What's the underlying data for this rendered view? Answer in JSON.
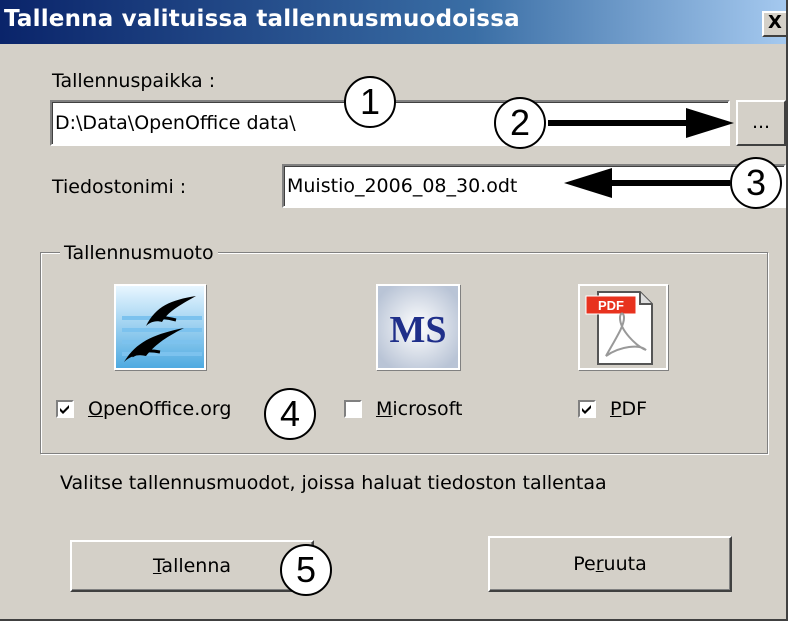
{
  "window": {
    "title": "Tallenna valituissa tallennusmuodoissa",
    "close_label": "X"
  },
  "location": {
    "label": "Tallennuspaikka :",
    "value": "D:\\Data\\OpenOffice data\\",
    "browse_label": "..."
  },
  "filename": {
    "label": "Tiedostonimi :",
    "value": "Muistio_2006_08_30.odt"
  },
  "formats": {
    "group_title": "Tallennusmuoto",
    "items": [
      {
        "key": "O",
        "rest": "penOffice.org",
        "checked": true,
        "icon": "openoffice-icon"
      },
      {
        "key": "M",
        "rest": "icrosoft",
        "checked": false,
        "icon": "ms-icon",
        "icon_text": "MS"
      },
      {
        "key": "P",
        "rest": "DF",
        "checked": true,
        "icon": "pdf-icon",
        "icon_text": "PDF"
      }
    ]
  },
  "hint": "Valitse tallennusmuodot, joissa haluat tiedoston tallentaa",
  "buttons": {
    "save": {
      "key": "T",
      "rest": "allenna"
    },
    "cancel": {
      "pre": "Pe",
      "key": "r",
      "rest": "uuta"
    }
  },
  "callouts": [
    "1",
    "2",
    "3",
    "4",
    "5"
  ],
  "colors": {
    "title_start": "#0a246a",
    "title_end": "#a6caf0",
    "face": "#d4d0c8",
    "pdf_red": "#e8321e"
  }
}
